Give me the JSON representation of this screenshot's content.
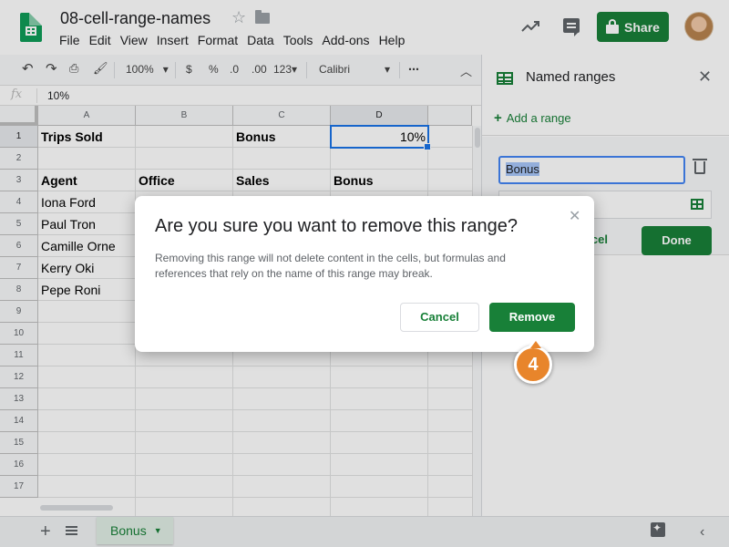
{
  "app": {
    "doc_title": "08-cell-range-names",
    "menu": [
      "File",
      "Edit",
      "View",
      "Insert",
      "Format",
      "Data",
      "Tools",
      "Add-ons",
      "Help"
    ],
    "share_label": "Share"
  },
  "toolbar": {
    "zoom": "100%",
    "currency": "$",
    "percent": "%",
    "decrease_decimal": ".0",
    "increase_decimal": ".00",
    "more_formats": "123",
    "font": "Calibri",
    "more": "⋯"
  },
  "formula_bar": {
    "fx": "fx",
    "value": "10%"
  },
  "grid": {
    "columns": [
      "A",
      "B",
      "C",
      "D"
    ],
    "rows": [
      "1",
      "2",
      "3",
      "4",
      "5",
      "6",
      "7",
      "8",
      "9",
      "10",
      "11",
      "12",
      "13",
      "14",
      "15",
      "16",
      "17"
    ],
    "cells": {
      "a1": "Trips Sold",
      "c1": "Bonus",
      "d1": "10%",
      "a3": "Agent",
      "b3": "Office",
      "c3": "Sales",
      "d3": "Bonus",
      "a4": "Iona Ford",
      "a5": "Paul Tron",
      "a6": "Camille Orne",
      "a7": "Kerry Oki",
      "a8": "Pepe Roni"
    }
  },
  "sheet_tabs": {
    "add": "+",
    "active_tab": "Bonus",
    "caret": "▼"
  },
  "side_panel": {
    "title": "Named ranges",
    "close": "✕",
    "add_range": "Add a range",
    "add_symbol": "+",
    "range_name": "Bonus",
    "cancel_label": "ncel",
    "done_label": "Done"
  },
  "dialog": {
    "title": "Are you sure you want to remove this range?",
    "body": "Removing this range will not delete content in the cells, but formulas and references that rely on the name of this range may break.",
    "cancel_label": "Cancel",
    "remove_label": "Remove",
    "close": "✕"
  },
  "callout": {
    "step": "4"
  },
  "colors": {
    "brand_green": "#188038",
    "callout_orange": "#e8852b",
    "selection_blue": "#1a73e8"
  }
}
